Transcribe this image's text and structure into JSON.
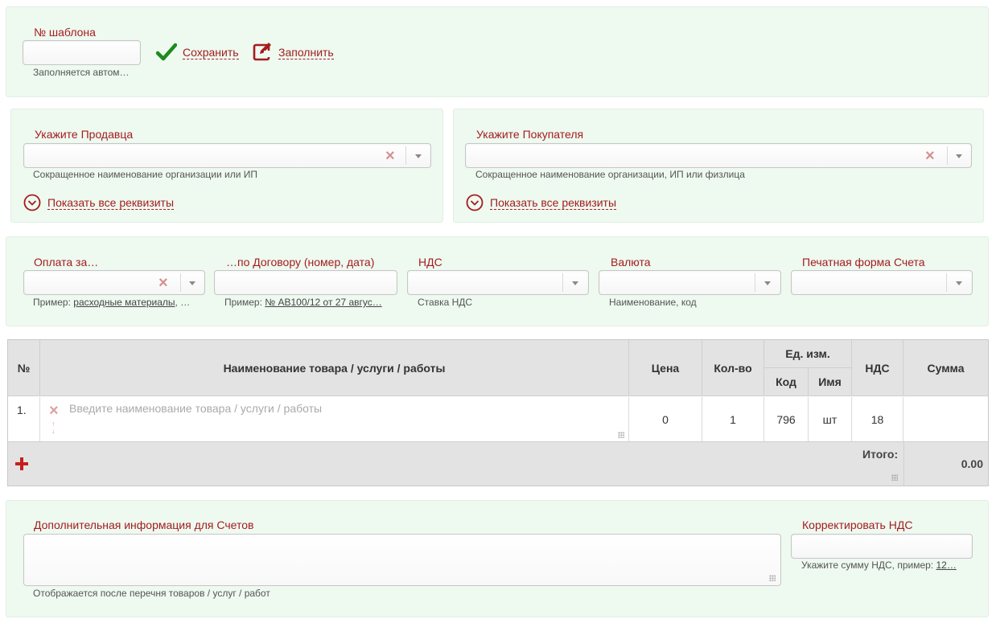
{
  "template": {
    "label": "№ шаблона",
    "value": "",
    "hint": "Заполняется автом…",
    "save_label": "Сохранить",
    "fill_label": "Заполнить"
  },
  "seller": {
    "label": "Укажите Продавца",
    "value": "",
    "hint": "Сокращенное наименование организации или ИП",
    "show_details": "Показать все реквизиты"
  },
  "buyer": {
    "label": "Укажите Покупателя",
    "value": "",
    "hint": "Сокращенное наименование организации, ИП или физлица",
    "show_details": "Показать все реквизиты"
  },
  "payment": {
    "label": "Оплата за…",
    "value": "",
    "hint_prefix": "Пример:",
    "hint_link": "расходные материалы",
    "hint_suffix": ", …"
  },
  "contract": {
    "label": "…по Договору (номер, дата)",
    "value": "",
    "hint_prefix": "Пример:",
    "hint_link": "№ АВ100/12 от 27 авгус…"
  },
  "vat": {
    "label": "НДС",
    "value": "",
    "hint": "Ставка НДС"
  },
  "currency": {
    "label": "Валюта",
    "value": "",
    "hint": "Наименование, код"
  },
  "print_form": {
    "label": "Печатная форма Счета",
    "value": ""
  },
  "items_table": {
    "headers": {
      "num": "№",
      "name": "Наименование товара / услуги / работы",
      "price": "Цена",
      "qty": "Кол-во",
      "unit": "Ед. изм.",
      "unit_code": "Код",
      "unit_name": "Имя",
      "vat": "НДС",
      "sum": "Сумма"
    },
    "rows": [
      {
        "num": "1.",
        "name_placeholder": "Введите наименование товара / услуги / работы",
        "price": "0",
        "qty": "1",
        "unit_code": "796",
        "unit_name": "шт",
        "vat": "18",
        "sum": ""
      }
    ],
    "total_label": "Итого:",
    "total_value": "0.00"
  },
  "extra_info": {
    "label": "Дополнительная информация для Счетов",
    "value": "",
    "hint": "Отображается после перечня товаров / услуг / работ"
  },
  "correct_vat": {
    "label": "Корректировать НДС",
    "value": "",
    "hint_prefix": "Укажите сумму НДС, пример:",
    "hint_link": "12…"
  },
  "colors": {
    "panel_bg": "#eef9f0",
    "accent_red": "#a31d1d",
    "check_green": "#1f8a1f",
    "table_header_bg": "#e3e3e3"
  }
}
